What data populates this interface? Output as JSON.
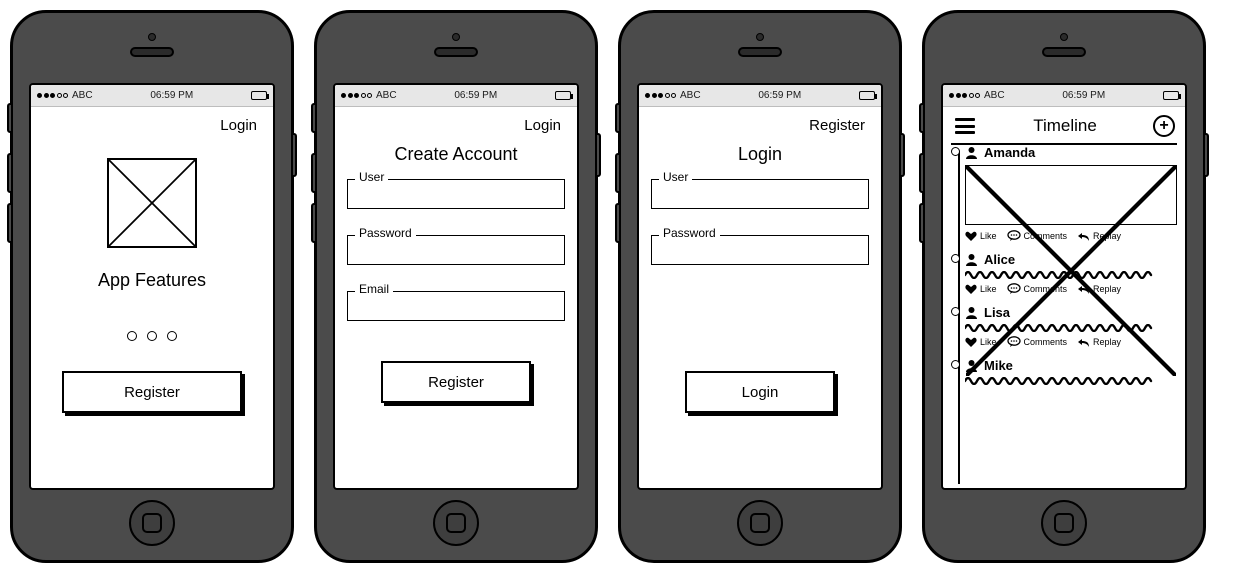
{
  "status": {
    "carrier": "ABC",
    "time": "06:59 PM"
  },
  "screen1": {
    "top_link": "Login",
    "features_title": "App Features",
    "register_btn": "Register"
  },
  "screen2": {
    "top_link": "Login",
    "title": "Create Account",
    "user_label": "User",
    "password_label": "Password",
    "email_label": "Email",
    "register_btn": "Register"
  },
  "screen3": {
    "top_link": "Register",
    "title": "Login",
    "user_label": "User",
    "password_label": "Password",
    "login_btn": "Login"
  },
  "screen4": {
    "title": "Timeline",
    "like": "Like",
    "comments": "Comments",
    "replay": "Replay",
    "posts": [
      {
        "user": "Amanda"
      },
      {
        "user": "Alice"
      },
      {
        "user": "Lisa"
      },
      {
        "user": "Mike"
      }
    ]
  }
}
